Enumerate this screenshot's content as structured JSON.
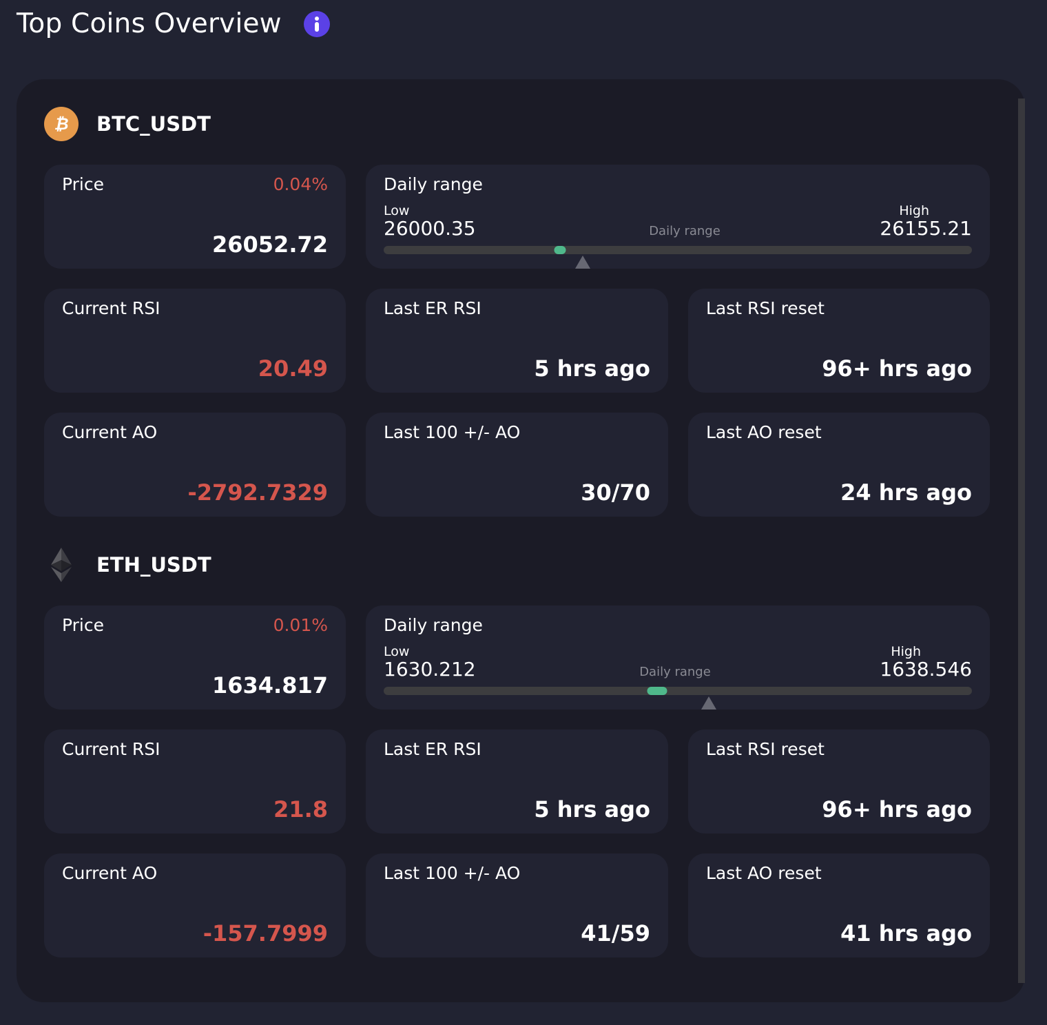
{
  "header": {
    "title": "Top Coins Overview",
    "info_icon": "info-icon"
  },
  "colors": {
    "background": "#212332",
    "panel": "#1b1b26",
    "card": "#222332",
    "negative": "#d5564d",
    "range_marker": "#4fb88b",
    "info_accent": "#5b41e6",
    "btc_brand": "#e69a4b"
  },
  "coins": [
    {
      "symbol": "BTC_USDT",
      "icon": "bitcoin-icon",
      "price": {
        "label": "Price",
        "change": "0.04%",
        "value": "26052.72"
      },
      "daily_range": {
        "title": "Daily range",
        "low_label": "Low",
        "low": "26000.35",
        "high_label": "High",
        "high": "26155.21",
        "center_label": "Daily range",
        "marker_fraction": 0.3,
        "price_fraction": 0.338
      },
      "current_rsi": {
        "label": "Current RSI",
        "value": "20.49"
      },
      "last_er_rsi": {
        "label": "Last ER RSI",
        "value": "5 hrs ago"
      },
      "last_rsi_reset": {
        "label": "Last RSI reset",
        "value": "96+ hrs ago"
      },
      "current_ao": {
        "label": "Current AO",
        "value": "-2792.7329"
      },
      "last_100_ao": {
        "label": "Last 100 +/- AO",
        "value": "30/70"
      },
      "last_ao_reset": {
        "label": "Last AO reset",
        "value": "24 hrs ago"
      }
    },
    {
      "symbol": "ETH_USDT",
      "icon": "ethereum-icon",
      "price": {
        "label": "Price",
        "change": "0.01%",
        "value": "1634.817"
      },
      "daily_range": {
        "title": "Daily range",
        "low_label": "Low",
        "low": "1630.212",
        "high_label": "High",
        "high": "1638.546",
        "center_label": "Daily range",
        "marker_fraction": 0.465,
        "price_fraction": 0.553
      },
      "current_rsi": {
        "label": "Current RSI",
        "value": "21.8"
      },
      "last_er_rsi": {
        "label": "Last ER RSI",
        "value": "5 hrs ago"
      },
      "last_rsi_reset": {
        "label": "Last RSI reset",
        "value": "96+ hrs ago"
      },
      "current_ao": {
        "label": "Current AO",
        "value": "-157.7999"
      },
      "last_100_ao": {
        "label": "Last 100 +/- AO",
        "value": "41/59"
      },
      "last_ao_reset": {
        "label": "Last AO reset",
        "value": "41 hrs ago"
      }
    }
  ]
}
